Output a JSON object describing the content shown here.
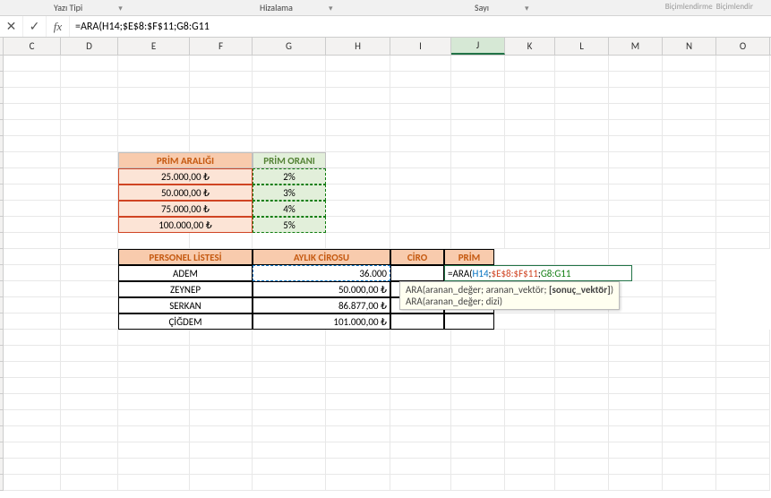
{
  "ribbon": {
    "font_group": "Yazı Tipi",
    "alignment_group": "Hizalama",
    "number_group": "Sayı",
    "top_right_1": "Biçimlendirme",
    "top_right_2": "Biçimlendir",
    "launcher": "▾"
  },
  "formula_bar": {
    "cancel": "✕",
    "confirm": "✓",
    "fx": "fx",
    "formula": "=ARA(H14;$E$8:$F$11;G8:G11"
  },
  "columns": [
    "C",
    "D",
    "E",
    "F",
    "G",
    "H",
    "I",
    "J",
    "K",
    "L",
    "M",
    "N",
    "O"
  ],
  "active_column": "J",
  "prim_table": {
    "header_range": "PRİM ARALIĞI",
    "header_rate": "PRİM ORANI",
    "rows": [
      {
        "range": "25.000,00 ₺",
        "rate": "2%"
      },
      {
        "range": "50.000,00 ₺",
        "rate": "3%"
      },
      {
        "range": "75.000,00 ₺",
        "rate": "4%"
      },
      {
        "range": "100.000,00 ₺",
        "rate": "5%"
      }
    ]
  },
  "personnel": {
    "header_list": "PERSONEL LİSTESİ",
    "header_monthly": "AYLIK CİROSU",
    "header_ciro": "CİRO",
    "header_prim": "PRİM",
    "rows": [
      {
        "name": "ADEM",
        "amount": "36.000"
      },
      {
        "name": "ZEYNEP",
        "amount": "50.000,00 ₺"
      },
      {
        "name": "SERKAN",
        "amount": "86.877,00 ₺"
      },
      {
        "name": "ÇİĞDEM",
        "amount": "101.000,00 ₺"
      }
    ]
  },
  "active_formula": {
    "prefix": "=ARA(",
    "arg1": "H14",
    "sep1": ";",
    "arg2": "$E$8:$F$11",
    "sep2": ";",
    "arg3": "G8:G11"
  },
  "hint": {
    "line1_pre": "ARA(aranan_değer; aranan_vektör; ",
    "line1_hl": "[sonuç_vektör]",
    "line1_post": ")",
    "line2": "ARA(aranan_değer; dizi)"
  }
}
